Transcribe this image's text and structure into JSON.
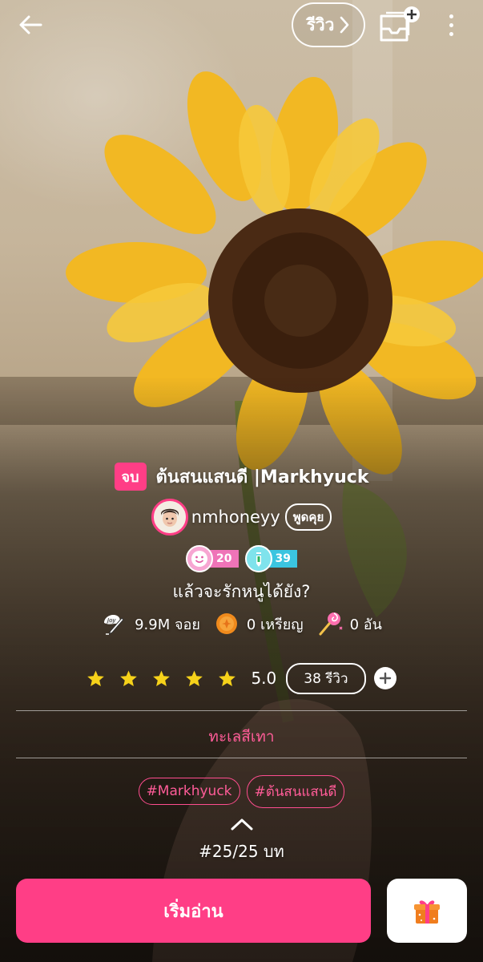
{
  "topbar": {
    "back_icon": "arrow-left-icon",
    "review_label": "รีวิว",
    "library_icon": "add-to-shelf-icon",
    "more_icon": "vertical-dots-icon"
  },
  "story": {
    "status": "จบ",
    "title": "ต้นสนแสนดี |Markhyuck",
    "author": "nmhoneyy",
    "chat_label": "พูดคุย",
    "badges": [
      {
        "icon": "smiley-badge-icon",
        "value": "20"
      },
      {
        "icon": "pencil-badge-icon",
        "value": "39"
      }
    ],
    "tagline": "แล้วจะรักหนูได้ยัง?",
    "stats": {
      "views": "9.9M จอย",
      "coins": "0 เหรียญ",
      "candies": "0 อัน"
    },
    "rating": {
      "stars": 5,
      "value": "5.0",
      "reviews_label": "38 รีวิว"
    },
    "category": "ทะเลสีเทา",
    "tags": [
      "#Markhyuck",
      "#ต้นสนแสนดี"
    ],
    "chapters": "#25/25 บท"
  },
  "actions": {
    "start_label": "เริ่มอ่าน",
    "gift_icon": "gift-box-icon"
  },
  "colors": {
    "accent": "#ff3e86",
    "tag_text": "#ff5c98",
    "star": "#f6d21a"
  }
}
